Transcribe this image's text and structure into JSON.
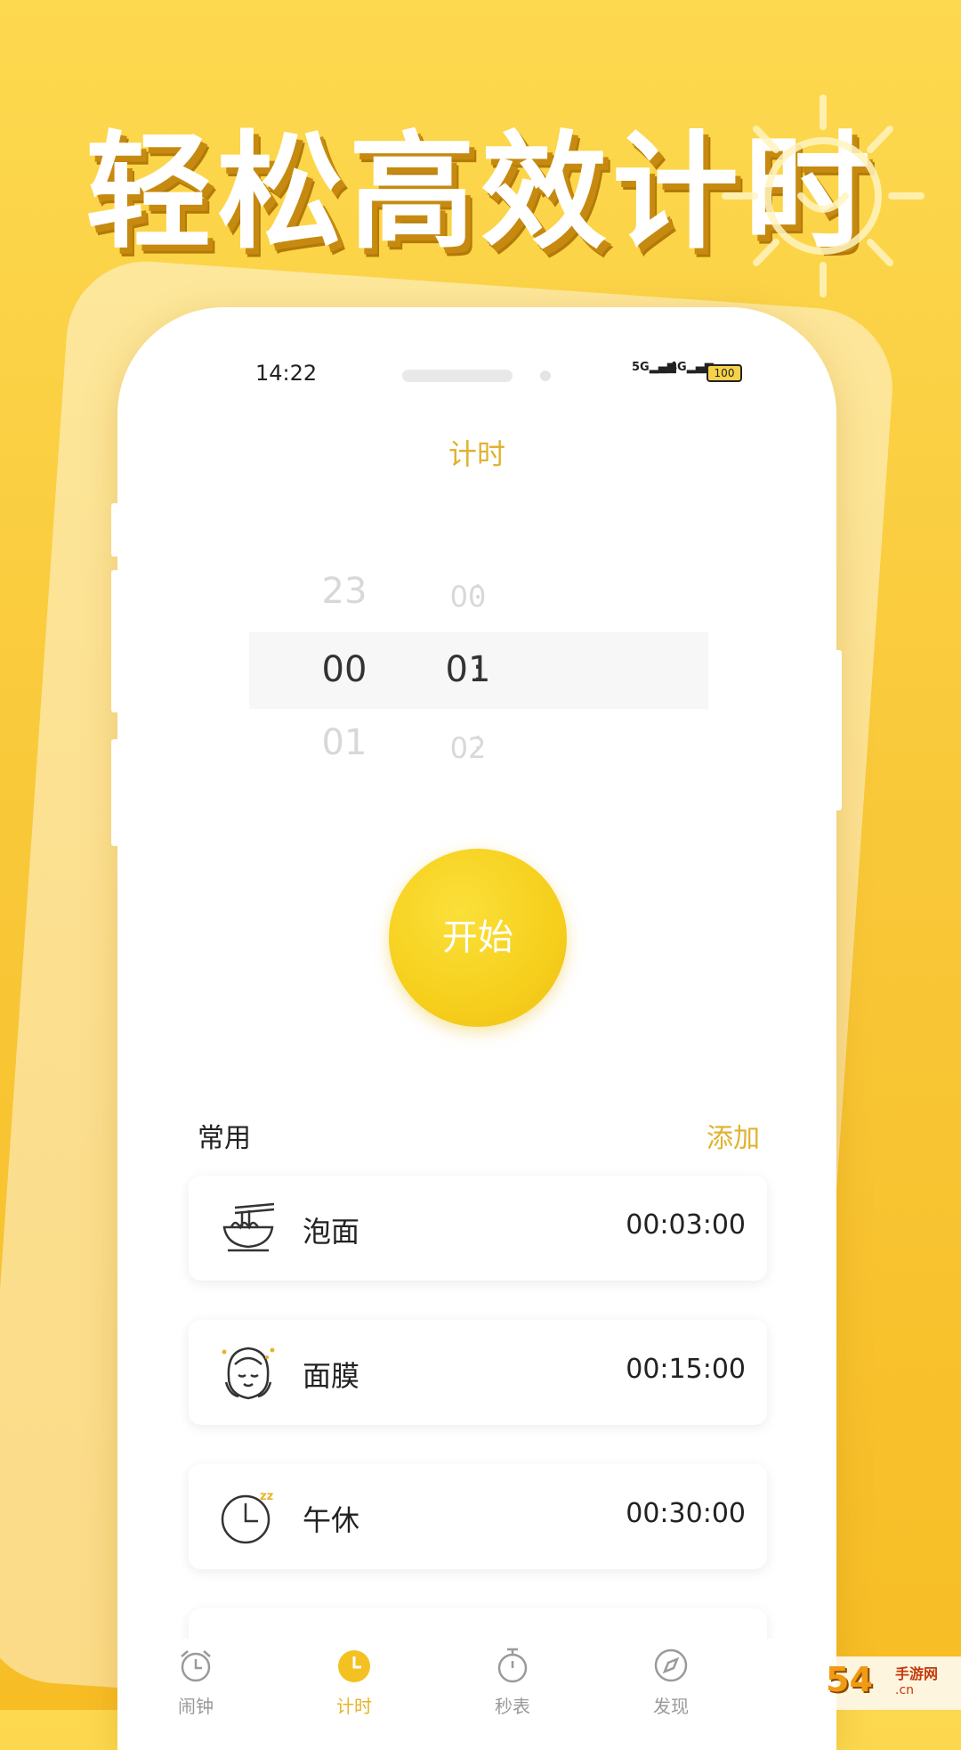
{
  "banner": {
    "headline": "轻松高效计时"
  },
  "status_bar": {
    "time": "14:22",
    "sig1": "5G",
    "sig2": "4G",
    "battery": "100"
  },
  "page": {
    "title": "计时"
  },
  "picker": {
    "above": {
      "hour": "23",
      "minute": "00"
    },
    "selected": {
      "hour": "00",
      "minute": "01"
    },
    "below": {
      "hour": "01",
      "minute": "02"
    },
    "separator": ":"
  },
  "start_button": {
    "label": "开始"
  },
  "presets": {
    "section_label": "常用",
    "add_label": "添加",
    "items": [
      {
        "icon": "noodle-bowl-icon",
        "name": "泡面",
        "duration": "00:03:00"
      },
      {
        "icon": "face-mask-icon",
        "name": "面膜",
        "duration": "00:15:00"
      },
      {
        "icon": "nap-clock-icon",
        "name": "午休",
        "duration": "00:30:00"
      }
    ]
  },
  "tabbar": {
    "items": [
      {
        "icon": "alarm-clock-icon",
        "label": "闹钟",
        "active": false
      },
      {
        "icon": "timer-clock-icon",
        "label": "计时",
        "active": true
      },
      {
        "icon": "stopwatch-icon",
        "label": "秒表",
        "active": false
      },
      {
        "icon": "compass-icon",
        "label": "发现",
        "active": false
      }
    ]
  },
  "colors": {
    "accent": "#e8b22a",
    "background": "#f9c93a",
    "start_button": "#f6cf1c"
  },
  "watermark": {
    "logo": "54",
    "site_name": "手游网",
    "domain": ".cn"
  }
}
